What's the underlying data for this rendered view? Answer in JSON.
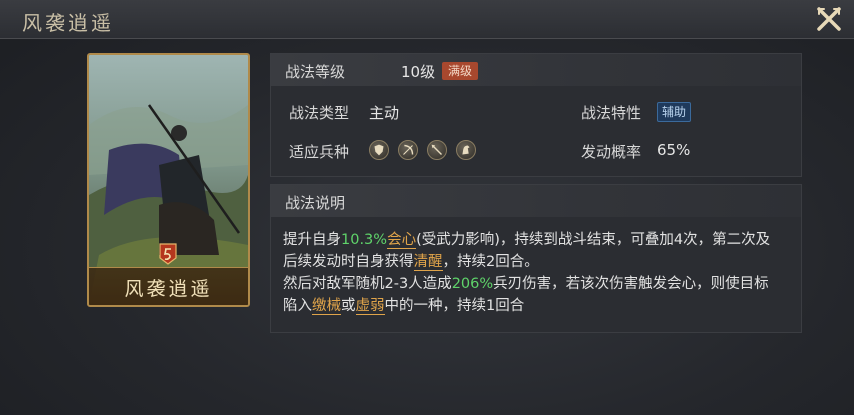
{
  "header": {
    "title": "风袭逍遥"
  },
  "card": {
    "name": "风袭逍遥"
  },
  "stats": {
    "level_label": "战法等级",
    "level_value": "10级",
    "level_tag": "满级",
    "type_label": "战法类型",
    "type_value": "主动",
    "trait_label": "战法特性",
    "trait_tag": "辅助",
    "troops_label": "适应兵种",
    "rate_label": "发动概率",
    "rate_value": "65%"
  },
  "troop_icons": [
    "shield-icon",
    "bow-icon",
    "spear-icon",
    "horse-icon"
  ],
  "description": {
    "heading": "战法说明",
    "p1": "提升自身",
    "v1": "10.3%",
    "k1": "会心",
    "p2": "(受武力影响)，持续到战斗结束，可叠加4次，第二次及后续发动时自身获得",
    "k2": "清醒",
    "p3": "，持续2回合。",
    "p4": "然后对敌军随机2-3人造成",
    "v2": "206%",
    "p5": "兵刃伤害，若该次伤害触发会心，则使目标陷入",
    "k3": "缴械",
    "p6": "或",
    "k4": "虚弱",
    "p7": "中的一种，持续1回合"
  },
  "colors": {
    "highlight_value": "#5fd36a",
    "keyword": "#e0a44a",
    "max_tag": "#a8482e",
    "aux_tag": "#1f3a5c",
    "card_border": "#b08a4a"
  }
}
